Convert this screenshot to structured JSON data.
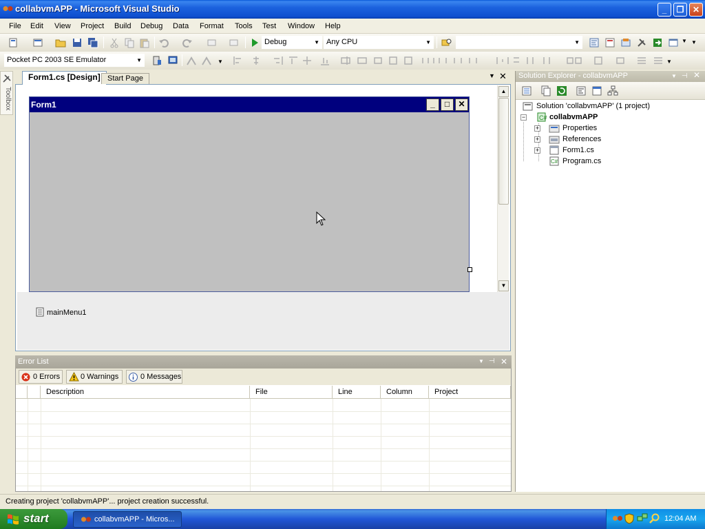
{
  "window": {
    "title": "collabvmAPP - Microsoft Visual Studio",
    "controls": {
      "minimize": "_",
      "restore": "❐",
      "close": "✕"
    }
  },
  "menu": [
    "File",
    "Edit",
    "View",
    "Project",
    "Build",
    "Debug",
    "Data",
    "Format",
    "Tools",
    "Test",
    "Window",
    "Help"
  ],
  "toolbar": {
    "configuration": "Debug",
    "platform": "Any CPU",
    "find_box": "",
    "device": "Pocket PC 2003 SE Emulator"
  },
  "toolbox": {
    "label": "Toolbox"
  },
  "document": {
    "tabs": [
      {
        "label": "Form1.cs [Design]",
        "active": true
      },
      {
        "label": "Start Page",
        "active": false
      }
    ],
    "form": {
      "title": "Form1",
      "buttons": [
        "_",
        "□",
        "✕"
      ]
    },
    "tray_components": [
      "mainMenu1"
    ]
  },
  "error_list": {
    "title": "Error List",
    "filters": [
      "0 Errors",
      "0 Warnings",
      "0 Messages"
    ],
    "columns": [
      "Description",
      "File",
      "Line",
      "Column",
      "Project"
    ]
  },
  "solution_explorer": {
    "title": "Solution Explorer - collabvmAPP",
    "tree": {
      "solution": "Solution 'collabvmAPP' (1 project)",
      "project": "collabvmAPP",
      "items": [
        "Properties",
        "References",
        "Form1.cs",
        "Program.cs"
      ]
    }
  },
  "status": {
    "text": "Creating project 'collabvmAPP'... project creation successful."
  },
  "taskbar": {
    "start_label": "start",
    "task": "collabvmAPP - Micros...",
    "clock": "12:04 AM"
  },
  "colors": {
    "titlebar": "#0a58d8",
    "form_caption": "#00007e",
    "form_client": "#c0c0c0",
    "start_button": "#2e8b2e"
  }
}
